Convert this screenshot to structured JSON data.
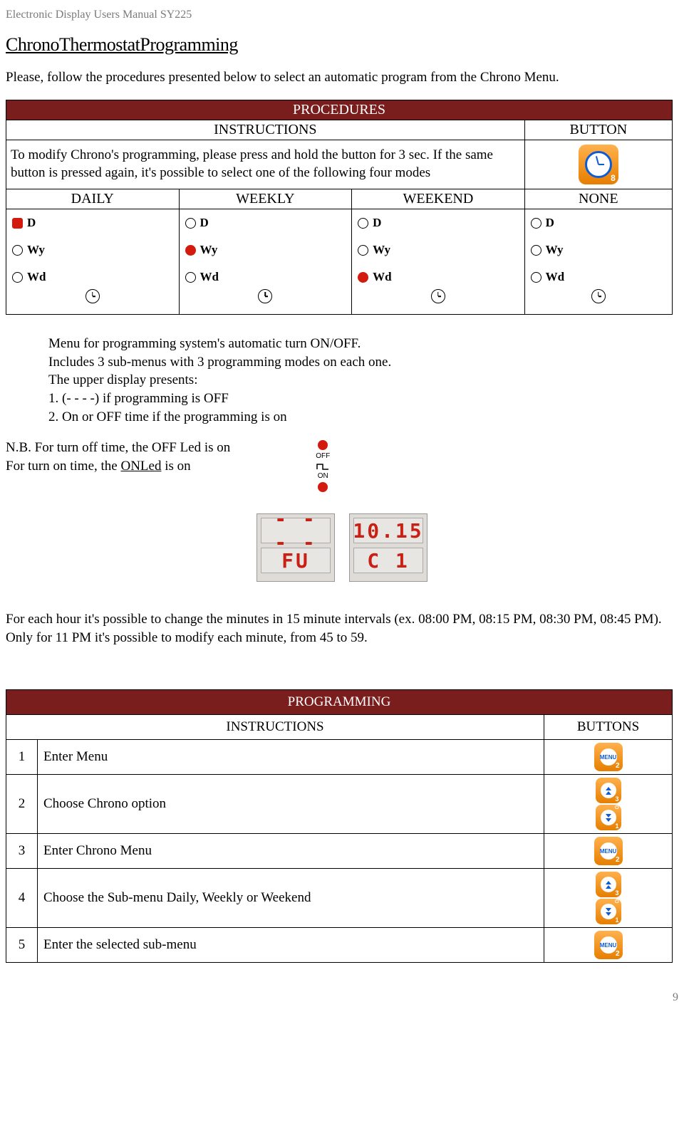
{
  "header": "Electronic Display Users Manual SY225",
  "title": "ChronoThermostatProgramming",
  "intro": "Please, follow the procedures presented below to select an automatic program from the Chrono Menu.",
  "proc": {
    "hdr": "PROCEDURES",
    "col1": "INSTRUCTIONS",
    "col2": "BUTTON",
    "instr": "To modify Chrono's programming, please press and hold the button for 3 sec. If the same button is pressed again, it's possible to select one of the following four modes",
    "btn_num": "8",
    "modes": [
      "DAILY",
      "WEEKLY",
      "WEEKEND",
      "NONE"
    ],
    "mode_labels": {
      "d": "D",
      "wy": "Wy",
      "wd": "Wd"
    }
  },
  "desc": {
    "l1": "Menu for programming system's automatic turn ON/OFF.",
    "l2": "Includes 3 sub-menus with 3 programming modes on each one.",
    "l3": "The upper display presents:",
    "l4": "1.   (- - - -) if programming is OFF",
    "l5": "2.   On or OFF time if the programming is on"
  },
  "nb": {
    "l1": "N.B. For turn off time, the OFF Led is on",
    "l2a": "For turn on time, the ",
    "l2b": "ONLed",
    "l2c": " is on",
    "off": "OFF",
    "on": "ON"
  },
  "lcd": {
    "a1": "- - - -",
    "a2": "FU",
    "b1": "10.15",
    "b2": "C 1"
  },
  "interval": "For each hour it's possible to change the minutes in 15 minute intervals (ex. 08:00 PM, 08:15 PM, 08:30 PM, 08:45 PM). Only for 11 PM it's possible to modify each minute, from 45 to 59.",
  "prog": {
    "hdr": "PROGRAMMING",
    "col1": "INSTRUCTIONS",
    "col2": "BUTTONS",
    "rows": [
      {
        "n": "1",
        "t": "Enter Menu",
        "btn": "menu"
      },
      {
        "n": "2",
        "t": "Choose Chrono option",
        "btn": "arrows"
      },
      {
        "n": "3",
        "t": "Enter Chrono Menu",
        "btn": "menu"
      },
      {
        "n": "4",
        "t": "Choose the Sub-menu Daily, Weekly or Weekend",
        "btn": "arrows"
      },
      {
        "n": "5",
        "t": "Enter the selected sub-menu",
        "btn": "menu"
      }
    ],
    "menu_label": "MENU",
    "menu_num": "2"
  },
  "page": "9"
}
